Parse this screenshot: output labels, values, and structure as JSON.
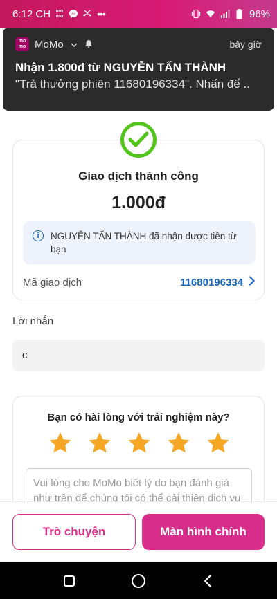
{
  "status_bar": {
    "time": "6:12 CH",
    "battery": "96%",
    "left_icons": [
      "momo-icon",
      "messenger-icon",
      "missed-call-icon",
      "more-dots-icon"
    ],
    "right_icons": [
      "vibrate-icon",
      "wifi-icon",
      "signal-icon",
      "battery-icon"
    ]
  },
  "notification": {
    "app_logo": "mo mo",
    "app_name": "MoMo",
    "time": "bây giờ",
    "title": "Nhận 1.800đ từ NGUYỄN TẤN THÀNH",
    "body": "\"Trả thưởng phiên 11680196334\". Nhấn để .."
  },
  "result": {
    "title": "Giao dịch thành công",
    "amount": "1.000đ",
    "info": "NGUYỄN TẤN THÀNH đã nhận được tiền từ bạn",
    "txn_label": "Mã giao dịch",
    "txn_value": "11680196334",
    "info_icon": "i"
  },
  "message": {
    "label": "Lời nhắn",
    "value": "c"
  },
  "rating": {
    "title": "Bạn có hài lòng với trải nghiệm này?",
    "stars": 5,
    "star_color": "#f5a623",
    "placeholder": "Vui lòng cho MoMo biết lý do bạn đánh giá như trên để chúng tôi có thể cải thiện dịch vụ"
  },
  "actions": {
    "chat_label": "Trò chuyện",
    "home_label": "Màn hình chính"
  },
  "colors": {
    "accent": "#d82d8b",
    "success": "#52c41a",
    "link": "#1565c0"
  }
}
